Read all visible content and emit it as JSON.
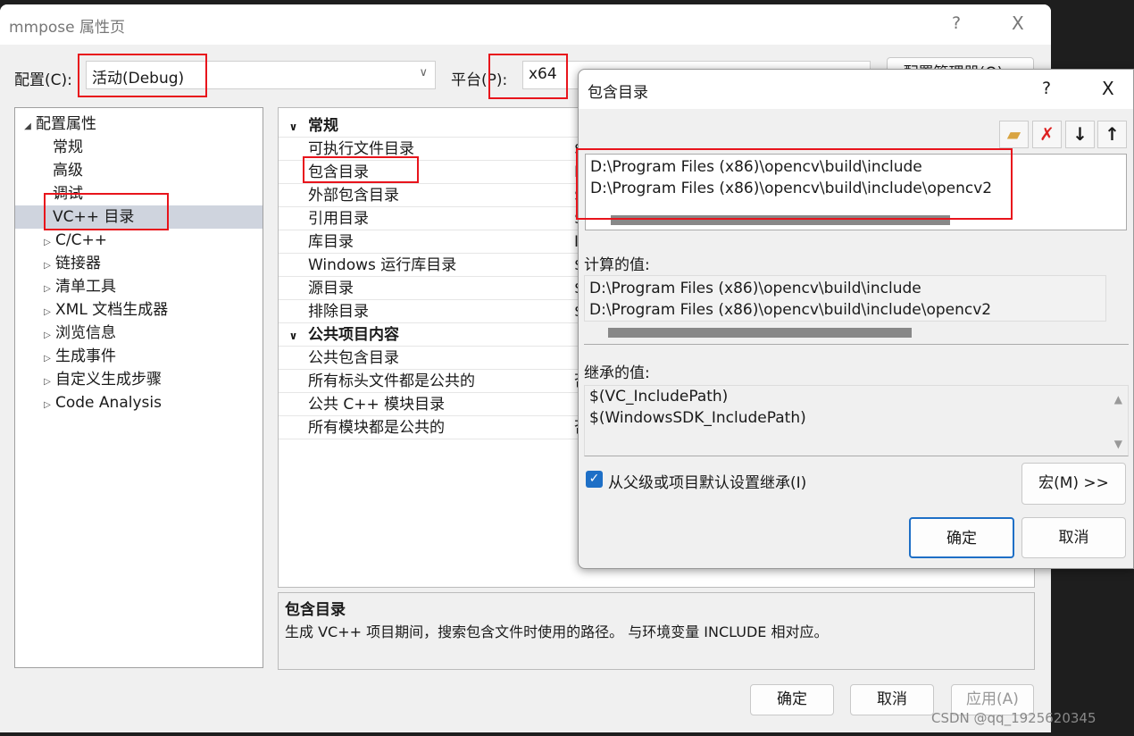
{
  "main_window": {
    "title": "mmpose 属性页",
    "help": "?",
    "close": "X",
    "config_label": "配置(C):",
    "config_value": "活动(Debug)",
    "platform_label": "平台(P):",
    "platform_value": "x64",
    "config_manager": "配置管理器(O)...",
    "tree": [
      {
        "label": "配置属性",
        "expanded": true,
        "level": 0
      },
      {
        "label": "常规",
        "level": 1
      },
      {
        "label": "高级",
        "level": 1
      },
      {
        "label": "调试",
        "level": 1
      },
      {
        "label": "VC++ 目录",
        "level": 1,
        "selected": true
      },
      {
        "label": "C/C++",
        "level": 1,
        "collapsed": true
      },
      {
        "label": "链接器",
        "level": 1,
        "collapsed": true
      },
      {
        "label": "清单工具",
        "level": 1,
        "collapsed": true
      },
      {
        "label": "XML 文档生成器",
        "level": 1,
        "collapsed": true
      },
      {
        "label": "浏览信息",
        "level": 1,
        "collapsed": true
      },
      {
        "label": "生成事件",
        "level": 1,
        "collapsed": true
      },
      {
        "label": "自定义生成步骤",
        "level": 1,
        "collapsed": true
      },
      {
        "label": "Code Analysis",
        "level": 1,
        "collapsed": true
      }
    ],
    "grid": [
      {
        "category": "常规"
      },
      {
        "name": "可执行文件目录",
        "value": "$"
      },
      {
        "name": "包含目录",
        "value": "I"
      },
      {
        "name": "外部包含目录",
        "value": "$"
      },
      {
        "name": "引用目录",
        "value": "$"
      },
      {
        "name": "库目录",
        "value": "I"
      },
      {
        "name": "Windows 运行库目录",
        "value": "$"
      },
      {
        "name": "源目录",
        "value": "$"
      },
      {
        "name": "排除目录",
        "value": "$"
      },
      {
        "category": "公共项目内容"
      },
      {
        "name": "公共包含目录",
        "value": ""
      },
      {
        "name": "所有标头文件都是公共的",
        "value": "否"
      },
      {
        "name": "公共 C++ 模块目录",
        "value": ""
      },
      {
        "name": "所有模块都是公共的",
        "value": "否"
      }
    ],
    "description_title": "包含目录",
    "description_text": "生成 VC++ 项目期间，搜索包含文件时使用的路径。 与环境变量 INCLUDE 相对应。",
    "ok": "确定",
    "cancel": "取消",
    "apply": "应用(A)"
  },
  "include_dialog": {
    "title": "包含目录",
    "help": "?",
    "close": "X",
    "toolbar": [
      "new-folder",
      "delete",
      "move-down",
      "move-up"
    ],
    "entries": [
      "D:\\Program Files (x86)\\opencv\\build\\include",
      "D:\\Program Files (x86)\\opencv\\build\\include\\opencv2"
    ],
    "computed_label": "计算的值:",
    "computed": [
      "D:\\Program Files (x86)\\opencv\\build\\include",
      "D:\\Program Files (x86)\\opencv\\build\\include\\opencv2"
    ],
    "inherited_label": "继承的值:",
    "inherited": [
      "$(VC_IncludePath)",
      "$(WindowsSDK_IncludePath)"
    ],
    "inherit_checkbox": "从父级或项目默认设置继承(I)",
    "inherit_checked": true,
    "macros": "宏(M) >>",
    "ok": "确定",
    "cancel": "取消"
  },
  "watermark": "CSDN @qq_1925620345"
}
